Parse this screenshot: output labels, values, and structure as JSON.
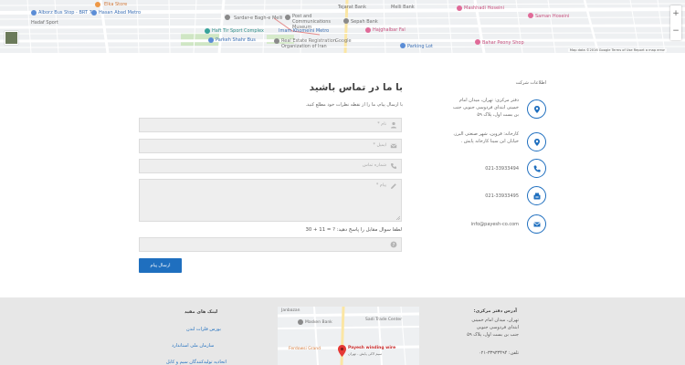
{
  "top_map": {
    "labels": {
      "elka_store": "Elka Store",
      "alborz_bus_stop": "Alborz Bus Stop - BRT 7",
      "hasan_abad_metro": "Hasan Abad Metro",
      "hadaf_sport": "Hadaf Sport",
      "sardar_e_bagh_e_melli": "Sardar-e Bagh-e Melli",
      "post_and_communications_museum": "Post and Communications Museum",
      "haft_tir_sport_complex": "Haft Tir Sport Complex",
      "imam_khomeini_metro": "Imam Khomeini Metro",
      "parkeh_shahr_bus": "Parkeh Shahr Bus",
      "real_estate_registration": "Real Estate Registration Organization of Iran",
      "tejarat_bank": "Tejarat Bank",
      "sepah_bank": "Sepah Bank",
      "melli_bank": "Melli Bank",
      "parking_lot": "Parking Lot",
      "haj_hasan": "Hajghalbar Fal",
      "mashhadi_hoseini": "Mashhadi Hoseini",
      "saman_hoseini": "Saman Hoseini",
      "bahar_peony_shop": "Bahar Peony Shop"
    },
    "google_logo": "Google",
    "attribution": "Map data ©2016 Google   Terms of Use   Report a map error",
    "zoom_in": "+",
    "zoom_out": "−"
  },
  "company_info": {
    "title": "اطلاعات شرکت",
    "items": [
      {
        "icon": "map-marker-icon",
        "text": "دفتر مرکزی: تهران، میدان امام خمینی ابتدای فردوسی جنوبی جنب بن بست اول، پلاک ۵۹"
      },
      {
        "icon": "map-marker-icon",
        "text": "کارخانه: قزوین، شهر صنعتی البرز، خیابان ابن سینا کارخانه پایش ."
      },
      {
        "icon": "phone-icon",
        "text": "021-33933494"
      },
      {
        "icon": "fax-icon",
        "text": "021-33933495"
      },
      {
        "icon": "envelope-icon",
        "text": "info@payesh-co.com"
      }
    ]
  },
  "contact_form": {
    "title": "با ما در تماس باشید",
    "subtitle": "با ارسال پیام، ما را از نقطه نظرات خود مطلع کنید.",
    "name_placeholder": "نام *",
    "email_placeholder": "ایمیل *",
    "phone_placeholder": "شماره تماس",
    "message_placeholder": "پیام *",
    "captcha_question": "لطفا سوال مقابل را پاسخ دهید: ? = 11 + 30",
    "submit_label": "ارسال پیام"
  },
  "footer": {
    "address_title": "آدرس دفتر مرکزی:",
    "address_lines": [
      "تهران، میدان امام خمینی",
      "ابتدای فردوسی جنوبی",
      "جنب بن بست اول، پلاک ۵۹"
    ],
    "phone_line": "تلفن: ۳۳۹۳۳۴۹۴-۰۲۱",
    "links_title": "لینک های مفید",
    "links": [
      "بورس فلزات لندن",
      "سازمان ملی استاندارد",
      "اتحادیه تولیدکنندگان سیم و کابل"
    ],
    "map_labels": {
      "janbazan": "Janbazan",
      "masken_bank": "Masken Bank",
      "sadi_trade_center": "Sadi Trade Center",
      "ferdowsi_grand": "Ferdowsi Grand",
      "payesh_winding_wire": "Payesh winding wire",
      "payesh_sub": "سیم لاکی پایش - تهران"
    }
  }
}
